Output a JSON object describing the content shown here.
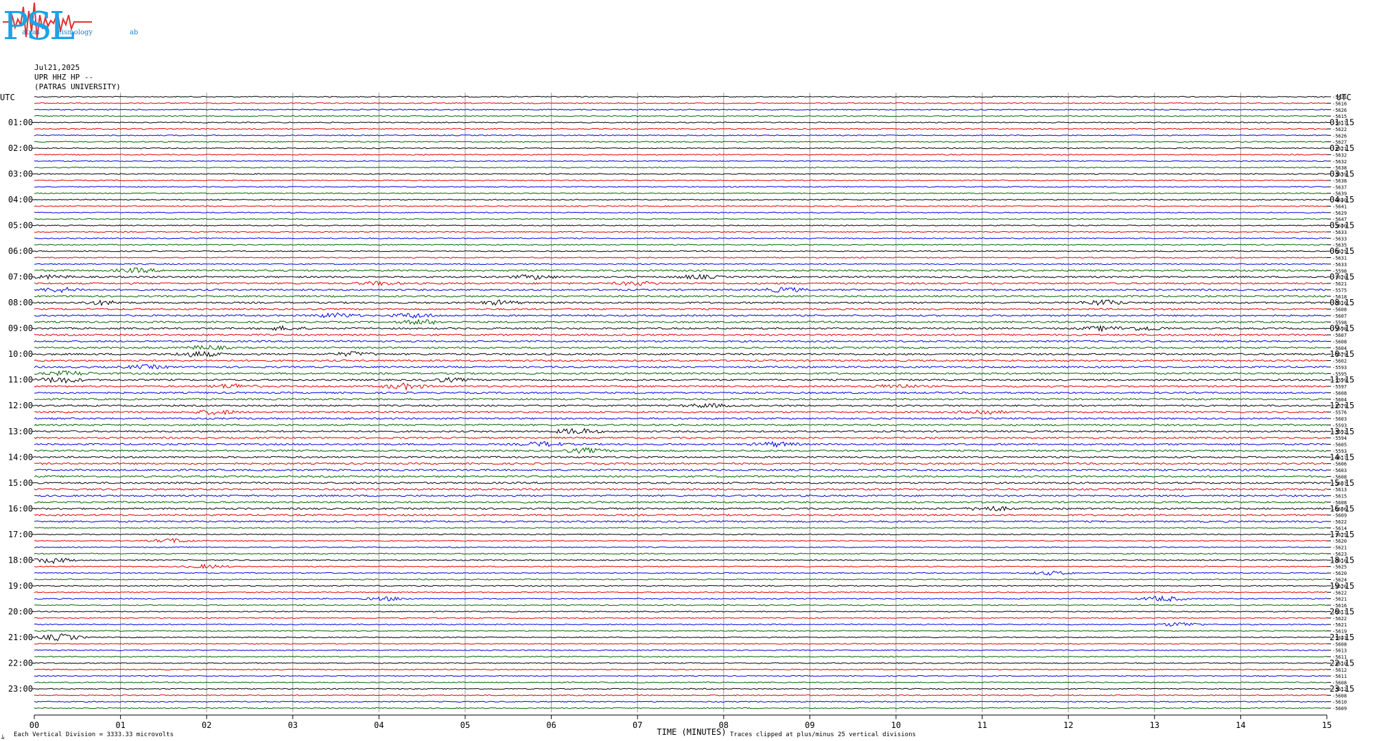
{
  "logo": {
    "text": "PSL",
    "subtitle_1": "atras",
    "subtitle_2": "eismology",
    "subtitle_3": "ab"
  },
  "header": {
    "date": "Jul21,2025",
    "station": "UPR HHZ HP --",
    "institution": "(PATRAS UNIVERSITY)"
  },
  "footer": {
    "scale_note": "Each Vertical Division = 3333.33 microvolts",
    "clip_note": "Traces clipped at plus/minus 25 vertical divisions",
    "corner_mark": "ﾑ"
  },
  "chart_data": {
    "type": "line",
    "title": "",
    "xlabel": "TIME (MINUTES)",
    "ylabel": "",
    "xlim": [
      0,
      15
    ],
    "x_ticks": [
      "00",
      "01",
      "02",
      "03",
      "04",
      "05",
      "06",
      "07",
      "08",
      "09",
      "10",
      "11",
      "12",
      "13",
      "14",
      "15"
    ],
    "left_axis_title": "UTC",
    "right_axis_title": "UTC",
    "left_hour_labels": [
      "01:00",
      "02:00",
      "03:00",
      "04:00",
      "05:00",
      "06:00",
      "07:00",
      "08:00",
      "09:00",
      "10:00",
      "11:00",
      "12:00",
      "13:00",
      "14:00",
      "15:00",
      "16:00",
      "17:00",
      "18:00",
      "19:00",
      "20:00",
      "21:00",
      "22:00",
      "23:00"
    ],
    "right_hour_labels": [
      "01:15",
      "02:15",
      "03:15",
      "04:15",
      "05:15",
      "06:15",
      "07:15",
      "08:15",
      "09:15",
      "10:15",
      "11:15",
      "12:15",
      "13:15",
      "14:15",
      "15:15",
      "16:15",
      "17:15",
      "18:15",
      "19:15",
      "20:15",
      "21:15",
      "22:15",
      "23:15"
    ],
    "trace_colors": [
      "#000000",
      "#e00000",
      "#0000e0",
      "#006400"
    ],
    "trace_count": 96,
    "trace_offsets": [
      -5621,
      -5616,
      -5626,
      -5615,
      -5617,
      -5622,
      -5626,
      -5627,
      -5621,
      -5632,
      -5632,
      -5638,
      -5639,
      -5638,
      -5637,
      -5639,
      -5640,
      -5641,
      -5629,
      -5647,
      -5640,
      -5633,
      -5633,
      -5635,
      -5625,
      -5631,
      -5633,
      -5598,
      -5620,
      -5621,
      -5575,
      -5618,
      -5616,
      -5608,
      -5607,
      -5598,
      -5598,
      -5607,
      -5608,
      -5604,
      -5579,
      -5602,
      -5593,
      -5595,
      -5599,
      -5597,
      -5608,
      -5604,
      -5579,
      -5576,
      -5603,
      -5593,
      -5592,
      -5594,
      -5605,
      -5593,
      -5617,
      -5606,
      -5603,
      -5608,
      -5607,
      -5613,
      -5615,
      -5608,
      -5606,
      -5609,
      -5622,
      -5614,
      -5625,
      -5620,
      -5621,
      -5623,
      -5616,
      -5625,
      -5620,
      -5624,
      -5626,
      -5622,
      -5621,
      -5616,
      -5617,
      -5622,
      -5621,
      -5619,
      -5643,
      -5608,
      -5613,
      -5611,
      -5610,
      -5612,
      -5611,
      -5608,
      -5612,
      -5608,
      -5610,
      -5609
    ],
    "events": [
      {
        "trace": 27,
        "minute": 1.2,
        "amp": 0.9
      },
      {
        "trace": 28,
        "minute": 0.2,
        "amp": 0.7
      },
      {
        "trace": 28,
        "minute": 5.8,
        "amp": 0.9
      },
      {
        "trace": 28,
        "minute": 7.7,
        "amp": 0.8
      },
      {
        "trace": 29,
        "minute": 4.0,
        "amp": 0.7
      },
      {
        "trace": 29,
        "minute": 7.0,
        "amp": 0.8
      },
      {
        "trace": 30,
        "minute": 0.3,
        "amp": 1.0
      },
      {
        "trace": 30,
        "minute": 8.7,
        "amp": 1.0
      },
      {
        "trace": 32,
        "minute": 0.8,
        "amp": 0.9
      },
      {
        "trace": 32,
        "minute": 5.4,
        "amp": 0.9
      },
      {
        "trace": 32,
        "minute": 12.4,
        "amp": 1.2
      },
      {
        "trace": 34,
        "minute": 3.5,
        "amp": 1.0
      },
      {
        "trace": 34,
        "minute": 4.4,
        "amp": 1.0
      },
      {
        "trace": 35,
        "minute": 4.5,
        "amp": 1.0
      },
      {
        "trace": 36,
        "minute": 2.9,
        "amp": 0.8
      },
      {
        "trace": 36,
        "minute": 12.4,
        "amp": 0.9
      },
      {
        "trace": 36,
        "minute": 12.9,
        "amp": 0.9
      },
      {
        "trace": 39,
        "minute": 2.0,
        "amp": 0.9
      },
      {
        "trace": 40,
        "minute": 1.9,
        "amp": 1.2
      },
      {
        "trace": 40,
        "minute": 3.7,
        "amp": 0.9
      },
      {
        "trace": 42,
        "minute": 1.3,
        "amp": 0.8
      },
      {
        "trace": 43,
        "minute": 0.4,
        "amp": 1.0
      },
      {
        "trace": 44,
        "minute": 0.3,
        "amp": 1.3
      },
      {
        "trace": 44,
        "minute": 4.8,
        "amp": 0.8
      },
      {
        "trace": 45,
        "minute": 2.3,
        "amp": 1.0
      },
      {
        "trace": 45,
        "minute": 4.3,
        "amp": 1.2
      },
      {
        "trace": 45,
        "minute": 10.0,
        "amp": 0.9
      },
      {
        "trace": 48,
        "minute": 7.8,
        "amp": 0.8
      },
      {
        "trace": 49,
        "minute": 2.1,
        "amp": 1.0
      },
      {
        "trace": 49,
        "minute": 11.0,
        "amp": 1.0
      },
      {
        "trace": 52,
        "minute": 6.3,
        "amp": 1.3
      },
      {
        "trace": 54,
        "minute": 5.9,
        "amp": 1.0
      },
      {
        "trace": 54,
        "minute": 8.6,
        "amp": 1.0
      },
      {
        "trace": 55,
        "minute": 6.4,
        "amp": 1.0
      },
      {
        "trace": 64,
        "minute": 11.1,
        "amp": 1.0
      },
      {
        "trace": 69,
        "minute": 1.6,
        "amp": 0.9
      },
      {
        "trace": 72,
        "minute": 0.2,
        "amp": 1.3
      },
      {
        "trace": 73,
        "minute": 2.0,
        "amp": 0.8
      },
      {
        "trace": 74,
        "minute": 11.8,
        "amp": 0.8
      },
      {
        "trace": 78,
        "minute": 4.1,
        "amp": 0.8
      },
      {
        "trace": 78,
        "minute": 13.1,
        "amp": 1.2
      },
      {
        "trace": 84,
        "minute": 0.3,
        "amp": 1.5
      },
      {
        "trace": 82,
        "minute": 13.3,
        "amp": 0.9
      }
    ]
  }
}
